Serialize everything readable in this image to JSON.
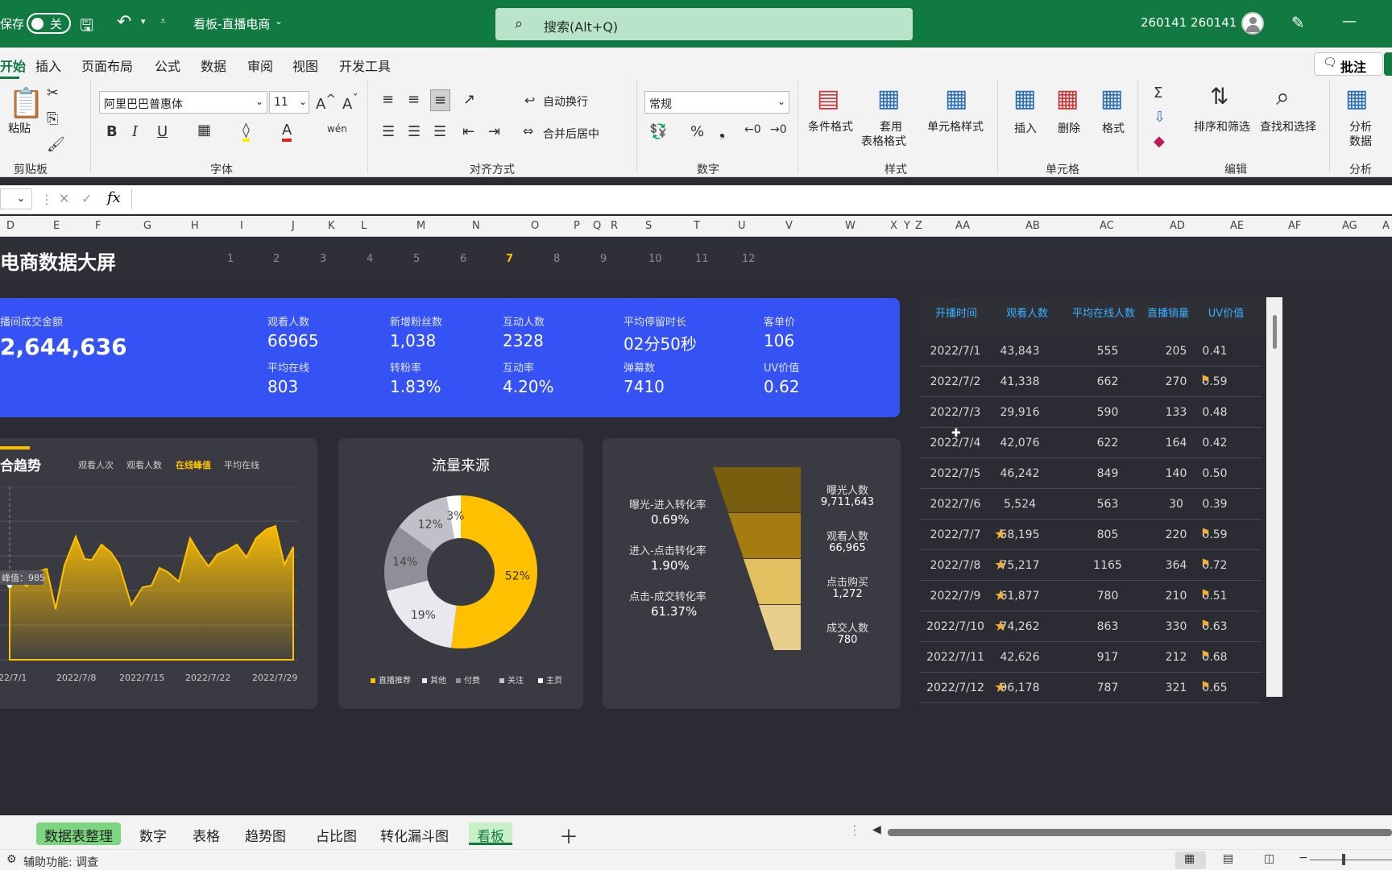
{
  "titlebar": {
    "autosave": "保存",
    "toggle_state": "关",
    "doc_title": "看板-直播电商",
    "search_placeholder": "搜索(Alt+Q)",
    "user": "260141 260141"
  },
  "menu_tabs": [
    "开始",
    "插入",
    "页面布局",
    "公式",
    "数据",
    "审阅",
    "视图",
    "开发工具"
  ],
  "comment_button": "批注",
  "ribbon": {
    "paste": "粘贴",
    "clipboard_group": "剪贴板",
    "font_name": "阿里巴巴普惠体",
    "font_size": "11",
    "font_group": "字体",
    "wrap_text": "自动换行",
    "merge_center": "合并后居中",
    "align_group": "对齐方式",
    "number_format": "常规",
    "number_group": "数字",
    "cond_format": "条件格式",
    "table_format_1": "套用",
    "table_format_2": "表格格式",
    "cell_style": "单元格样式",
    "style_group": "样式",
    "insert": "插入",
    "delete": "删除",
    "format": "格式",
    "cells_group": "单元格",
    "sort_filter": "排序和筛选",
    "find_select": "查找和选择",
    "edit_group": "编辑",
    "analyze_1": "分析",
    "analyze_2": "数据",
    "analyze_group": "分析"
  },
  "columns": [
    "D",
    "E",
    "F",
    "G",
    "H",
    "I",
    "J",
    "K",
    "L",
    "M",
    "N",
    "O",
    "P",
    "Q",
    "R",
    "S",
    "T",
    "U",
    "V",
    "W",
    "X",
    "Y",
    "Z",
    "AA",
    "AB",
    "AC",
    "AD",
    "AE",
    "AF",
    "AG",
    "A"
  ],
  "dashboard": {
    "title": "电商数据大屏",
    "months": [
      "1",
      "2",
      "3",
      "4",
      "5",
      "6",
      "7",
      "8",
      "9",
      "10",
      "11",
      "12"
    ],
    "active_month": "7"
  },
  "kpi": {
    "gmv_label": "播间成交金额",
    "gmv_value": "2,644,636",
    "items": [
      {
        "label": "观看人数",
        "value": "66965"
      },
      {
        "label": "新增粉丝数",
        "value": "1,038"
      },
      {
        "label": "互动人数",
        "value": "2328"
      },
      {
        "label": "平均停留时长",
        "value": "02分50秒"
      },
      {
        "label": "客单价",
        "value": "106"
      },
      {
        "label": "平均在线",
        "value": "803"
      },
      {
        "label": "转粉率",
        "value": "1.83%"
      },
      {
        "label": "互动率",
        "value": "4.20%"
      },
      {
        "label": "弹幕数",
        "value": "7410"
      },
      {
        "label": "UV价值",
        "value": "0.62"
      }
    ]
  },
  "trend": {
    "title": "合趋势",
    "legend": [
      "观看人次",
      "观看人数",
      "在线峰值",
      "平均在线"
    ],
    "active": "在线峰值",
    "tooltip": "峰值：985",
    "x_labels": [
      "22/7/1",
      "2022/7/8",
      "2022/7/15",
      "2022/7/22",
      "2022/7/29"
    ]
  },
  "chart_data": {
    "type": "pie",
    "title": "流量来源",
    "categories": [
      "直播推荐",
      "其他",
      "付费",
      "关注",
      "主页"
    ],
    "values": [
      52,
      19,
      14,
      12,
      3
    ],
    "labels": [
      "52%",
      "19%",
      "14%",
      "12%",
      "3%"
    ],
    "colors": [
      "#ffc000",
      "#e8e8ee",
      "#8f8f9a",
      "#c0c0c8",
      "#ffffff"
    ]
  },
  "funnel": {
    "rates": [
      {
        "label": "曝光-进入转化率",
        "value": "0.69%"
      },
      {
        "label": "进入-点击转化率",
        "value": "1.90%"
      },
      {
        "label": "点击-成交转化率",
        "value": "61.37%"
      }
    ],
    "stages": [
      {
        "label": "曝光人数",
        "value": "9,711,643"
      },
      {
        "label": "观看人数",
        "value": "66,965"
      },
      {
        "label": "点击购买",
        "value": "1,272"
      },
      {
        "label": "成交人数",
        "value": "780"
      }
    ]
  },
  "table": {
    "headers": [
      "开播时间",
      "观看人数",
      "平均在线人数",
      "直播销量",
      "UV价值"
    ],
    "rows": [
      [
        "2022/7/1",
        "43,843",
        "555",
        "205",
        "0.41",
        "",
        ""
      ],
      [
        "2022/7/2",
        "41,338",
        "662",
        "270",
        "0.59",
        "",
        "flag"
      ],
      [
        "2022/7/3",
        "29,916",
        "590",
        "133",
        "0.48",
        "",
        ""
      ],
      [
        "2022/7/4",
        "42,076",
        "622",
        "164",
        "0.42",
        "",
        ""
      ],
      [
        "2022/7/5",
        "46,242",
        "849",
        "140",
        "0.50",
        "",
        ""
      ],
      [
        "2022/7/6",
        "5,524",
        "563",
        "30",
        "0.39",
        "",
        ""
      ],
      [
        "2022/7/7",
        "58,195",
        "805",
        "220",
        "0.59",
        "star",
        "flag"
      ],
      [
        "2022/7/8",
        "75,217",
        "1165",
        "364",
        "0.72",
        "star",
        "flag"
      ],
      [
        "2022/7/9",
        "61,877",
        "780",
        "210",
        "0.51",
        "star",
        "flag"
      ],
      [
        "2022/7/10",
        "74,262",
        "863",
        "330",
        "0.63",
        "star",
        "flag"
      ],
      [
        "2022/7/11",
        "42,626",
        "917",
        "212",
        "0.68",
        "",
        "flag"
      ],
      [
        "2022/7/12",
        "96,178",
        "787",
        "321",
        "0.65",
        "star",
        "flag"
      ]
    ]
  },
  "sheets": [
    "数据表整理",
    "数字",
    "表格",
    "趋势图",
    "占比图",
    "转化漏斗图",
    "看板"
  ],
  "active_sheet": "看板",
  "status": {
    "accessibility": "辅助功能: 调查"
  }
}
